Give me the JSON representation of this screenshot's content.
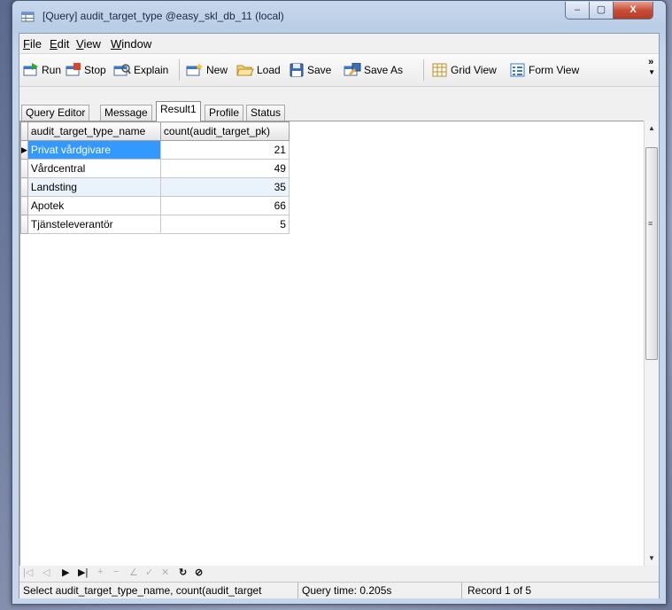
{
  "window": {
    "title": "[Query] audit_target_type @easy_skl_db_11 (local)",
    "controls": {
      "minimize": "–",
      "maximize": "▢",
      "close": "X"
    }
  },
  "menu": [
    {
      "label": "File",
      "u": "F",
      "rest": "ile"
    },
    {
      "label": "Edit",
      "u": "E",
      "rest": "dit"
    },
    {
      "label": "View",
      "u": "V",
      "rest": "iew"
    },
    {
      "label": "Window",
      "u": "W",
      "rest": "indow"
    }
  ],
  "toolbar": {
    "run": "Run",
    "stop": "Stop",
    "explain": "Explain",
    "new": "New",
    "load": "Load",
    "save": "Save",
    "save_as": "Save As",
    "grid_view": "Grid View",
    "form_view": "Form View",
    "more": "»"
  },
  "tabs": [
    "Query Editor",
    "Message",
    "Result1",
    "Profile",
    "Status"
  ],
  "active_tab": "Result1",
  "grid": {
    "columns": [
      "audit_target_type_name",
      "count(audit_target_pk)"
    ],
    "rows": [
      {
        "name": "Privat vårdgivare",
        "count": "21"
      },
      {
        "name": "Vårdcentral",
        "count": "49"
      },
      {
        "name": "Landsting",
        "count": "35"
      },
      {
        "name": "Apotek",
        "count": "66"
      },
      {
        "name": "Tjänsteleverantör",
        "count": "5"
      }
    ],
    "selected_row": 0,
    "row_indicator": "▶"
  },
  "navigator": {
    "first": "|◁",
    "prior": "◁",
    "next": "▶",
    "last": "▶|",
    "insert": "+",
    "delete": "−",
    "edit": "∠",
    "post": "✓",
    "cancel": "✕",
    "refresh": "↻",
    "stop": "⊘"
  },
  "status": {
    "sql": "Select audit_target_type_name, count(audit_target",
    "query_time": "Query time: 0.205s",
    "record": "Record 1 of 5"
  },
  "colors": {
    "selection": "#3399ff",
    "close_button": "#c94f37"
  }
}
